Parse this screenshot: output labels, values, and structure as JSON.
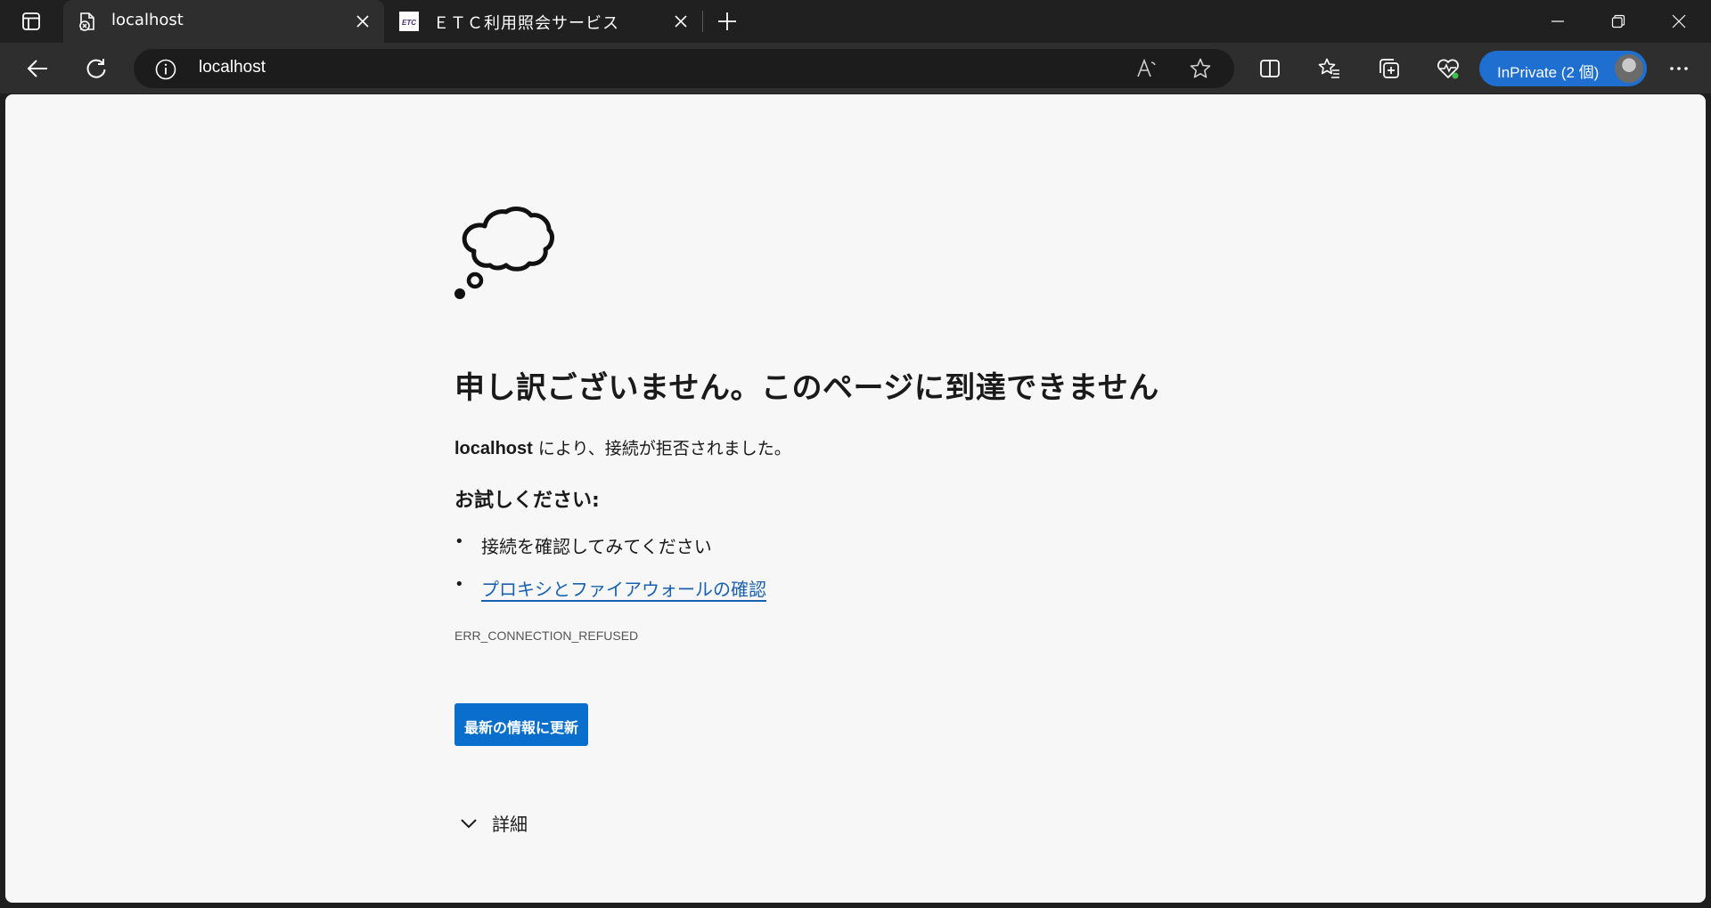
{
  "browser": {
    "tabs": [
      {
        "title": "localhost",
        "active": true
      },
      {
        "title": "ＥＴＣ利用照会サービス",
        "active": false,
        "favicon_text": "ETC"
      }
    ],
    "address": "localhost",
    "inprivate_label": "InPrivate (2 個)",
    "accent_color": "#1e6fd0"
  },
  "error_page": {
    "heading": "申し訳ございません。このページに到達できません",
    "host": "localhost",
    "desc_suffix": " により、接続が拒否されました。",
    "try_heading": "お試しください:",
    "suggestions": [
      "接続を確認してみてください",
      "プロキシとファイアウォールの確認"
    ],
    "error_code": "ERR_CONNECTION_REFUSED",
    "refresh_label": "最新の情報に更新",
    "details_label": "詳細",
    "link_color": "#1961b0"
  }
}
